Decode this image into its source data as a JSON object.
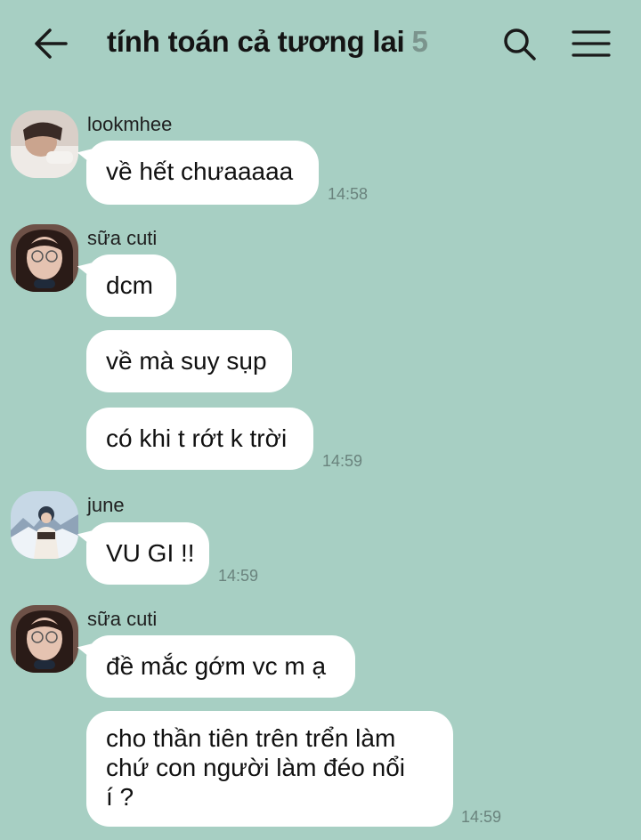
{
  "header": {
    "title": "tính toán cả tương lai",
    "member_count": "5",
    "back_icon": "arrow-left-icon",
    "search_icon": "search-icon",
    "menu_icon": "hamburger-menu-icon"
  },
  "messages": [
    {
      "sender": "lookmhee",
      "bubbles": [
        "về hết chưaaaaa"
      ],
      "time": "14:58"
    },
    {
      "sender": "sữa cuti",
      "bubbles": [
        "dcm",
        "về mà suy sụp",
        "có khi t rớt k trời"
      ],
      "time": "14:59"
    },
    {
      "sender": "june",
      "bubbles": [
        "VU GI !!"
      ],
      "time": "14:59"
    },
    {
      "sender": "sữa cuti",
      "bubbles": [
        "đề mắc gớm vc m ạ",
        "cho thần tiên trên trển làm",
        "chứ con người làm đéo nổi",
        "í ?"
      ],
      "time": "14:59"
    }
  ],
  "colors": {
    "background": "#a7cfc3",
    "bubble": "#ffffff",
    "time": "#6a837d",
    "count": "#7b948d"
  }
}
